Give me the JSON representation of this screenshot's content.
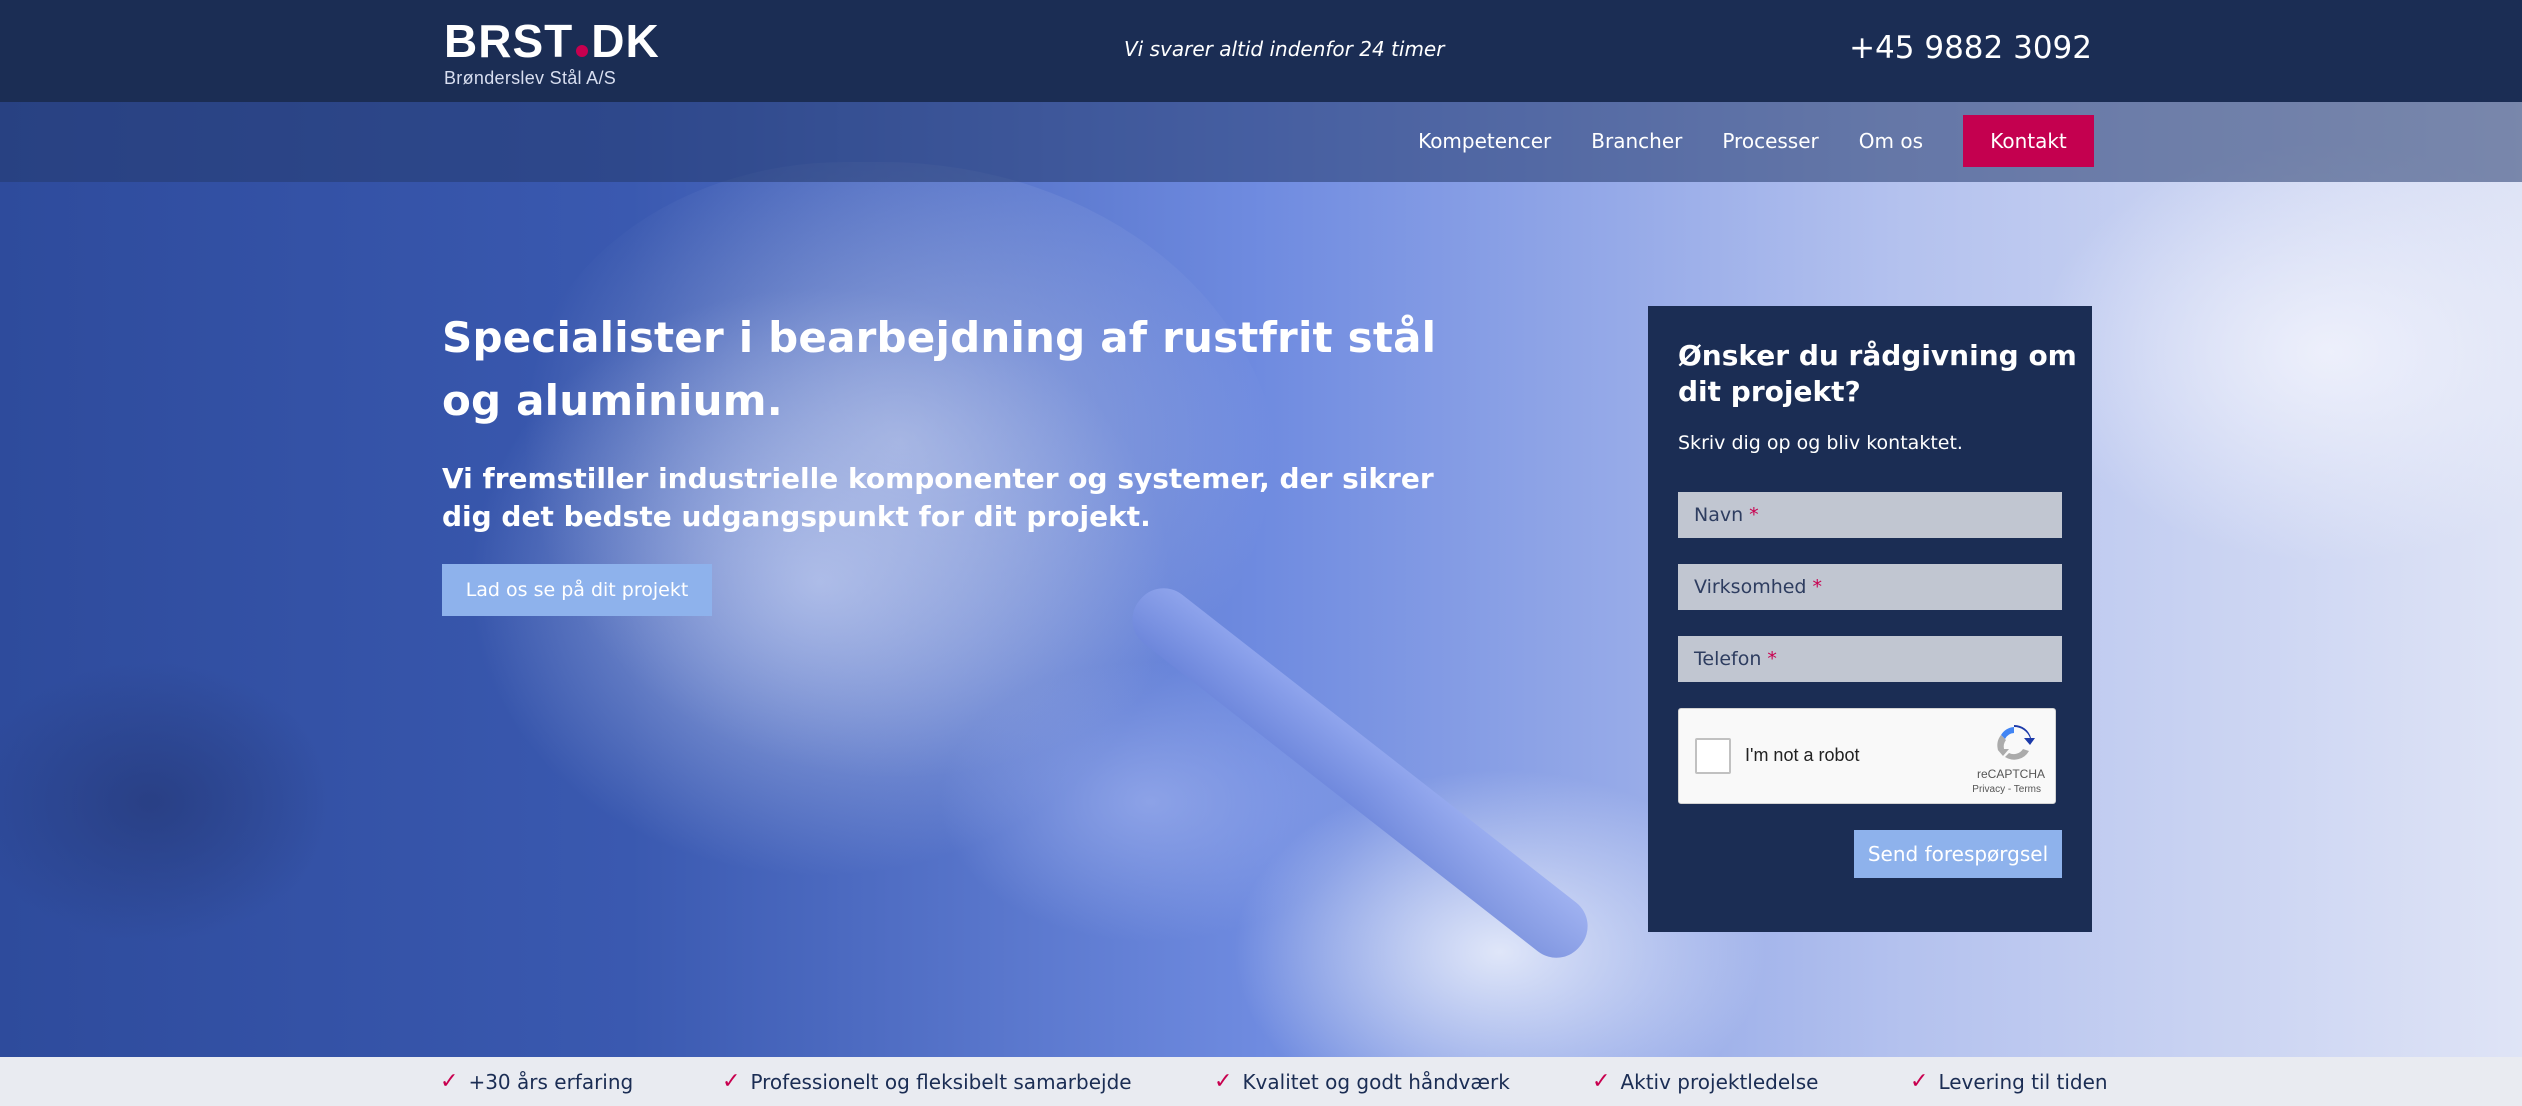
{
  "header": {
    "logo_text_left": "BRST",
    "logo_text_right": "DK",
    "logo_subtitle": "Brønderslev Stål A/S",
    "tagline": "Vi svarer altid indenfor 24 timer",
    "phone": "+45 9882 3092"
  },
  "nav": {
    "items": [
      {
        "label": "Kompetencer"
      },
      {
        "label": "Brancher"
      },
      {
        "label": "Processer"
      },
      {
        "label": "Om os"
      }
    ],
    "cta_label": "Kontakt"
  },
  "hero": {
    "title": "Specialister i bearbejdning af rustfrit stål og aluminium.",
    "subtitle": "Vi fremstiller industrielle komponenter og systemer, der sikrer dig det bedste udgangspunkt for dit projekt.",
    "button_label": "Lad os se på dit projekt"
  },
  "form": {
    "title": "Ønsker du rådgivning om dit projekt?",
    "subtitle": "Skriv dig op og bliv kontaktet.",
    "fields": [
      {
        "placeholder": "Navn",
        "required_mark": "*"
      },
      {
        "placeholder": "Virksomhed",
        "required_mark": "*"
      },
      {
        "placeholder": "Telefon",
        "required_mark": "*"
      }
    ],
    "recaptcha": {
      "label": "I'm not a robot",
      "brand": "reCAPTCHA",
      "links": "Privacy - Terms"
    },
    "submit_label": "Send forespørgsel"
  },
  "usps": [
    {
      "label": "+30 års erfaring"
    },
    {
      "label": "Professionelt og fleksibelt samarbejde"
    },
    {
      "label": "Kvalitet og godt håndværk"
    },
    {
      "label": "Aktiv projektledelse"
    },
    {
      "label": "Levering til tiden"
    }
  ],
  "usp_check_symbol": "✓",
  "colors": {
    "navy": "#1b2d54",
    "accent": "#c4004f",
    "button_light_blue": "#8eb2ec",
    "usp_bar": "#e9ebf1"
  }
}
